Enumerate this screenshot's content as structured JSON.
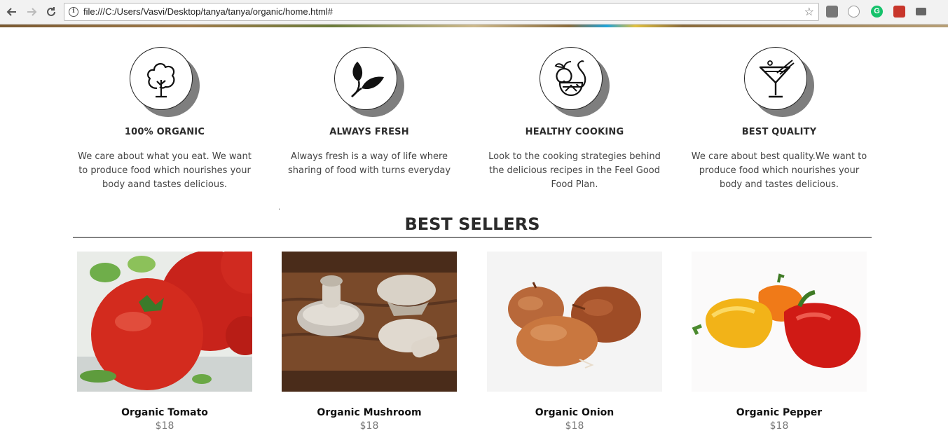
{
  "browser": {
    "url": "file:///C:/Users/Vasvi/Desktop/tanya/tanya/organic/home.html#",
    "ext_grammarly_letter": "G"
  },
  "features": [
    {
      "icon": "tree-icon",
      "title": "100% ORGANIC",
      "desc": "We care about what you eat. We want to produce food which nourishes your body aand tastes delicious."
    },
    {
      "icon": "leaf-icon",
      "title": "ALWAYS FRESH",
      "desc": "Always fresh is a way of life where sharing of food with turns everyday"
    },
    {
      "icon": "fruit-bowl-icon",
      "title": "HEALTHY COOKING",
      "desc": "Look to the cooking strategies behind the delicious recipes in the Feel Good Food Plan."
    },
    {
      "icon": "cocktail-icon",
      "title": "BEST QUALITY",
      "desc": "We care about best quality.We want to produce food which nourishes your body and tastes delicious."
    }
  ],
  "stray_dot": ".",
  "best_sellers": {
    "title": "BEST SELLERS",
    "products": [
      {
        "name": "Organic Tomato",
        "price": "$18",
        "image": "tomato-image"
      },
      {
        "name": "Organic Mushroom",
        "price": "$18",
        "image": "mushroom-image"
      },
      {
        "name": "Organic Onion",
        "price": "$18",
        "image": "onion-image"
      },
      {
        "name": "Organic Pepper",
        "price": "$18",
        "image": "pepper-image"
      }
    ]
  }
}
